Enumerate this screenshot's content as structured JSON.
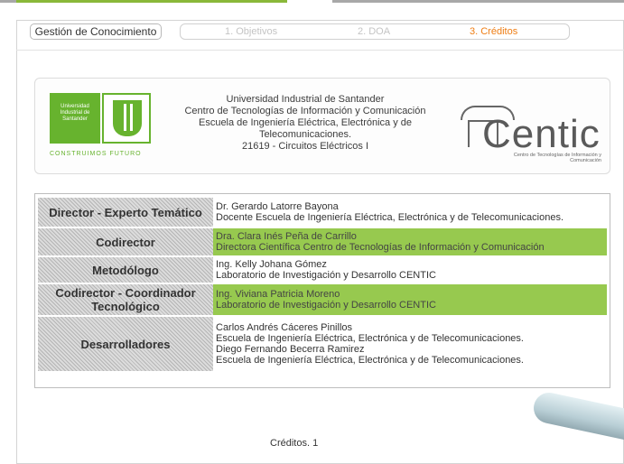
{
  "nav": {
    "home_label": "Gestión de Conocimiento",
    "steps": [
      "1. Objetivos",
      "2. DOA",
      "3. Créditos"
    ],
    "active_step": 3
  },
  "header": {
    "uis_logo": {
      "line1": "Universidad",
      "line2": "Industrial de",
      "line3": "Santander",
      "slogan": "CONSTRUIMOS FUTURO"
    },
    "institution_lines": [
      "Universidad Industrial de Santander",
      "Centro de Tecnologías de Información y Comunicación",
      "Escuela de Ingeniería Eléctrica, Electrónica y de",
      "Telecomunicaciones.",
      "21619 - Circuitos Eléctricos I"
    ],
    "centic_logo": {
      "word": "Centic",
      "subtitle": "Centro de Tecnologías de Información y Comunicación"
    }
  },
  "credits": [
    {
      "role": "Director - Experto Temático",
      "lines": [
        "Dr. Gerardo Latorre Bayona",
        "Docente Escuela de Ingeniería Eléctrica, Electrónica y de Telecomunicaciones."
      ],
      "highlight": false
    },
    {
      "role": "Codirector",
      "lines": [
        "Dra. Clara Inés Peña de Carrillo",
        "Directora Científica Centro de Tecnologías de Información y Comunicación"
      ],
      "highlight": true
    },
    {
      "role": "Metodólogo",
      "lines": [
        "Ing. Kelly Johana Gómez",
        "Laboratorio de Investigación y Desarrollo CENTIC"
      ],
      "highlight": false
    },
    {
      "role": "Codirector - Coordinador Tecnológico",
      "lines": [
        "Ing. Viviana Patricia Moreno",
        "Laboratorio de Investigación y Desarrollo CENTIC"
      ],
      "highlight": true
    },
    {
      "role": "Desarrolladores",
      "lines": [
        "Carlos Andrés Cáceres Pinillos",
        "Escuela de Ingeniería Eléctrica, Electrónica y de Telecomunicaciones.",
        "Diego Fernando Becerra Ramirez",
        "Escuela de Ingeniería Eléctrica, Electrónica y de Telecomunicaciones."
      ],
      "highlight": false
    }
  ],
  "footer": {
    "page_label": "Créditos. 1"
  },
  "colors": {
    "accent_green": "#97c94f",
    "active_step": "#ee7d14",
    "uis_green": "#67b32e"
  }
}
